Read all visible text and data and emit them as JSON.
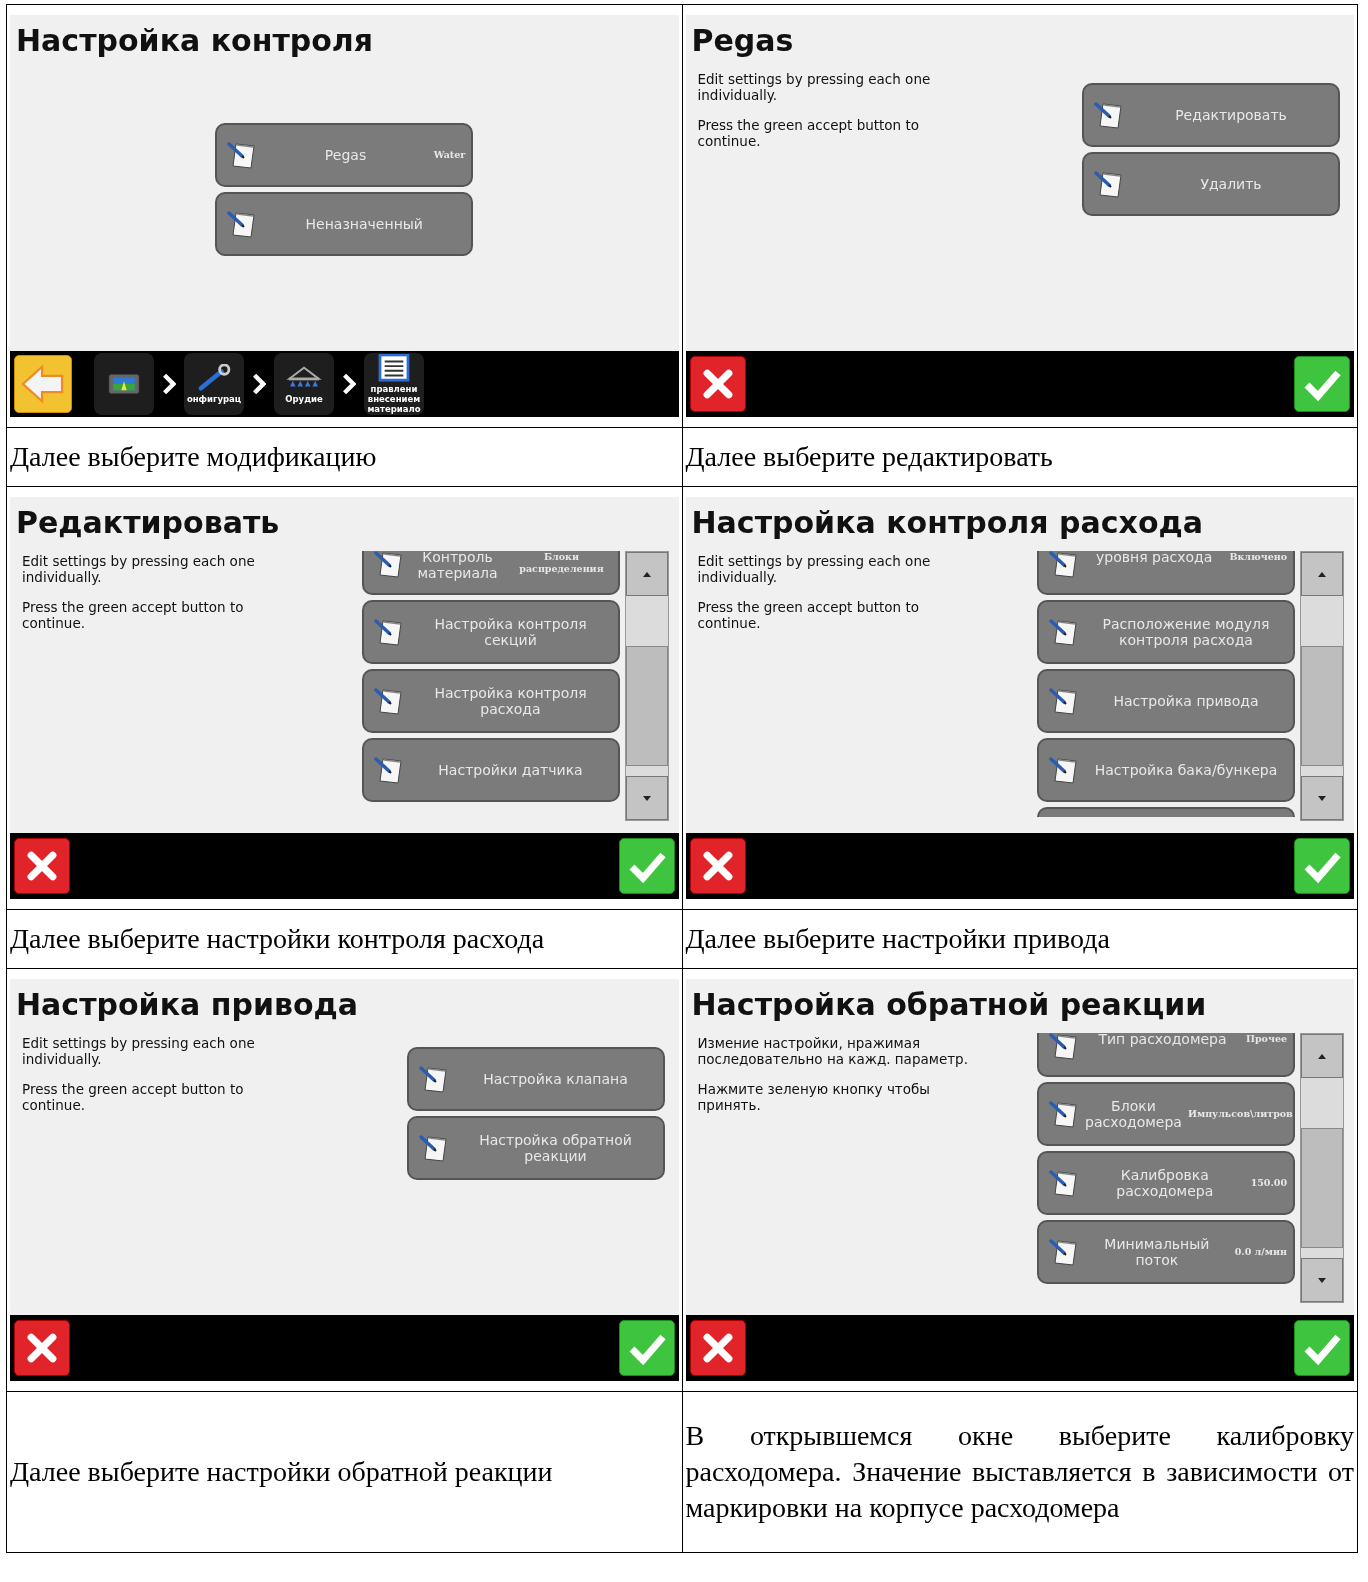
{
  "panels": [
    {
      "screen": {
        "title": "Настройка контроля",
        "list": {
          "items": [
            {
              "label": "Pegas",
              "value": "Water",
              "cut_top": false
            },
            {
              "label": "Неназначенный",
              "cut_top": false
            }
          ]
        },
        "bottom_bar": {
          "kind": "nav",
          "crumbs": [
            {
              "label": "онфигурац"
            },
            {
              "label": "Орудие"
            },
            {
              "label": "правлени внесением материало"
            }
          ]
        }
      },
      "caption": "Далее выберите модификацию"
    },
    {
      "screen": {
        "title": "Pegas",
        "instructions": [
          "Edit settings by pressing each one individually.",
          "Press the green accept button to continue."
        ],
        "list": {
          "items": [
            {
              "label": "Редактировать",
              "cut_top": false
            },
            {
              "label": "Удалить",
              "cut_top": false
            }
          ]
        },
        "bottom_bar": {
          "kind": "confirm"
        }
      },
      "caption": "Далее выберите редактировать"
    },
    {
      "screen": {
        "title": "Редактировать",
        "instructions": [
          "Edit settings by pressing each one individually.",
          "Press the green accept button to continue."
        ],
        "list": {
          "scrollbar": true,
          "items": [
            {
              "label": "Контроль материала",
              "value": "Блоки распределения",
              "cut_top": true
            },
            {
              "label": "Настройка контроля секций",
              "cut_top": false
            },
            {
              "label": "Настройка контроля расхода",
              "cut_top": false
            },
            {
              "label": "Настройки датчика",
              "cut_top": false
            }
          ]
        },
        "bottom_bar": {
          "kind": "confirm"
        }
      },
      "caption": "Далее выберите настройки контроля расхода"
    },
    {
      "screen": {
        "title": "Настройка контроля расхода",
        "instructions": [
          "Edit settings by pressing each one individually.",
          "Press the green accept button to continue."
        ],
        "list": {
          "scrollbar": true,
          "more_below": true,
          "items": [
            {
              "label": "уровня расхода",
              "value": "Включено",
              "cut_top": true
            },
            {
              "label": "Расположение модуля контроля расхода",
              "cut_top": false
            },
            {
              "label": "Настройка привода",
              "cut_top": false
            },
            {
              "label": "Настройка бака/бункера",
              "cut_top": false
            }
          ]
        },
        "bottom_bar": {
          "kind": "confirm"
        }
      },
      "caption": "Далее выберите настройки привода"
    },
    {
      "screen": {
        "title": "Настройка привода",
        "instructions": [
          "Edit settings by pressing each one individually.",
          "Press the green accept button to continue."
        ],
        "list": {
          "items": [
            {
              "label": "Настройка клапана",
              "cut_top": false
            },
            {
              "label": "Настройка обратной реакции",
              "cut_top": false
            }
          ]
        },
        "bottom_bar": {
          "kind": "confirm"
        }
      },
      "caption": "Далее выберите настройки обратной реакции"
    },
    {
      "screen": {
        "title": "Настройка обратной реакции",
        "instructions": [
          "Измение настройки, нражимая последовательно на кажд. параметр.",
          "Нажмите зеленую кнопку чтобы принять."
        ],
        "list": {
          "scrollbar": true,
          "items": [
            {
              "label": "Тип расходомера",
              "value": "Прочее",
              "cut_top": true
            },
            {
              "label": "Блоки расходомера",
              "value": "Импульсов\\литров",
              "cut_top": false
            },
            {
              "label": "Калибровка расходомера",
              "value": "150.00",
              "cut_top": false
            },
            {
              "label": "Минимальный поток",
              "value": "0.0 л/мин",
              "cut_top": false
            }
          ]
        },
        "bottom_bar": {
          "kind": "confirm"
        }
      },
      "caption": "В открывшемся окне выберите калибровку расходомера. Значение выставляется в зависимости от маркировки на корпусе расходомера"
    }
  ]
}
